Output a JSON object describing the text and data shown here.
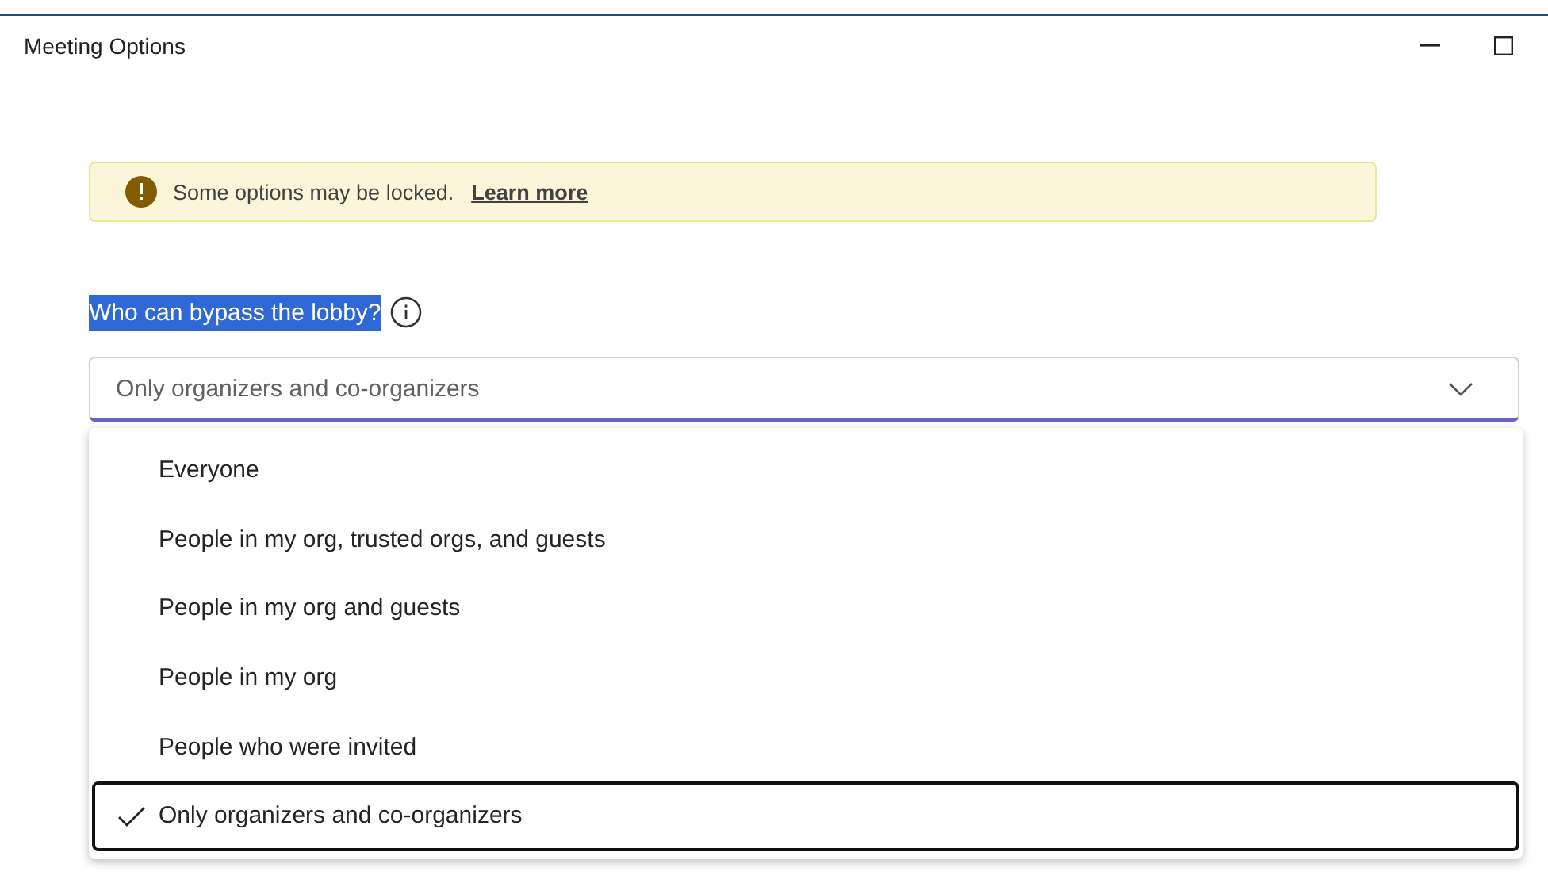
{
  "window": {
    "title": "Meeting Options"
  },
  "banner": {
    "text": "Some options may be locked.",
    "link": "Learn more"
  },
  "setting": {
    "label": "Who can bypass the lobby?",
    "label_highlighted": true,
    "value": "Only organizers and co-organizers",
    "expanded": true
  },
  "options": [
    {
      "label": "Everyone",
      "selected": false
    },
    {
      "label": "People in my org, trusted orgs, and guests",
      "selected": false
    },
    {
      "label": "People in my org and guests",
      "selected": false
    },
    {
      "label": "People in my org",
      "selected": false
    },
    {
      "label": "People who were invited",
      "selected": false
    },
    {
      "label": "Only organizers and co-organizers",
      "selected": true
    }
  ]
}
